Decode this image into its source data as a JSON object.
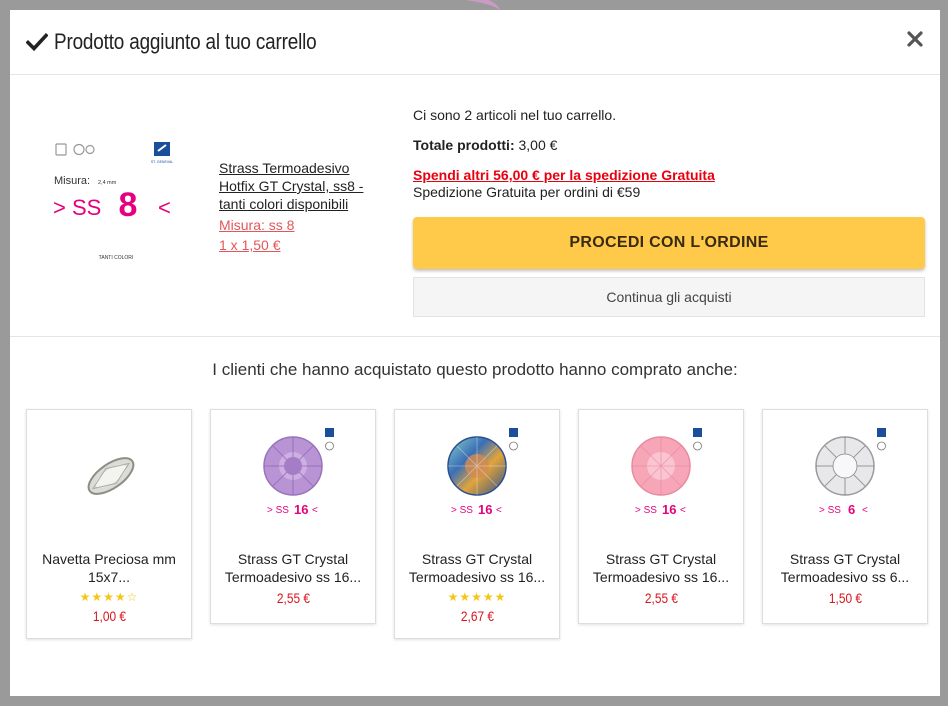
{
  "modal": {
    "title": "Prodotto aggiunto al tuo carrello",
    "close_label": "×"
  },
  "product": {
    "name": "Strass Termoadesivo Hotfix GT Crystal, ss8 - tanti colori disponibili",
    "attribute": "Misura: ss 8",
    "quantity_price": "1 x 1,50 €",
    "image": {
      "misura_label": "Misura:",
      "misura_mm": "2,4 mm",
      "size_text_left": "> SS",
      "size_number": "8",
      "size_text_right": "<",
      "colors_label": "TANTI COLORI",
      "brand_label": "ST. GENEVAL"
    }
  },
  "summary": {
    "cart_count_text": "Ci sono 2 articoli nel tuo carrello.",
    "total_label": "Totale prodotti:",
    "total_value": "3,00 €",
    "shipping_promo": "Spendi altri 56,00 € per la spedizione Gratuita",
    "shipping_info": "Spedizione Gratuita per ordini di €59",
    "checkout_label": "PROCEDI CON L'ORDINE",
    "continue_label": "Continua gli acquisti"
  },
  "recommendations": {
    "title": "I clienti che hanno acquistato questo prodotto hanno comprato anche:",
    "items": [
      {
        "name": "Navetta Preciosa mm 15x7...",
        "price": "1,00 €",
        "stars": "★★★★☆",
        "size_label": "",
        "size_number": "",
        "color": "#cfcfcf"
      },
      {
        "name": "Strass GT Crystal Termoadesivo ss 16...",
        "price": "2,55 €",
        "stars": "",
        "size_label": "> SS",
        "size_number": "16",
        "color": "#b894d4"
      },
      {
        "name": "Strass GT Crystal Termoadesivo ss 16...",
        "price": "2,67 €",
        "stars": "★★★★★",
        "size_label": "> SS",
        "size_number": "16",
        "color": "#3a8fbf"
      },
      {
        "name": "Strass GT Crystal Termoadesivo ss 16...",
        "price": "2,55 €",
        "stars": "",
        "size_label": "> SS",
        "size_number": "16",
        "color": "#f7a6b8"
      },
      {
        "name": "Strass GT Crystal Termoadesivo ss 6...",
        "price": "1,50 €",
        "stars": "",
        "size_label": "> SS",
        "size_number": "6",
        "color": "#e8e8ea"
      }
    ]
  },
  "colors": {
    "checkout_bg": "#ffc94a",
    "promo_red": "#e8000f",
    "price_red": "#d7141c",
    "accent_pink": "#e6007e"
  }
}
